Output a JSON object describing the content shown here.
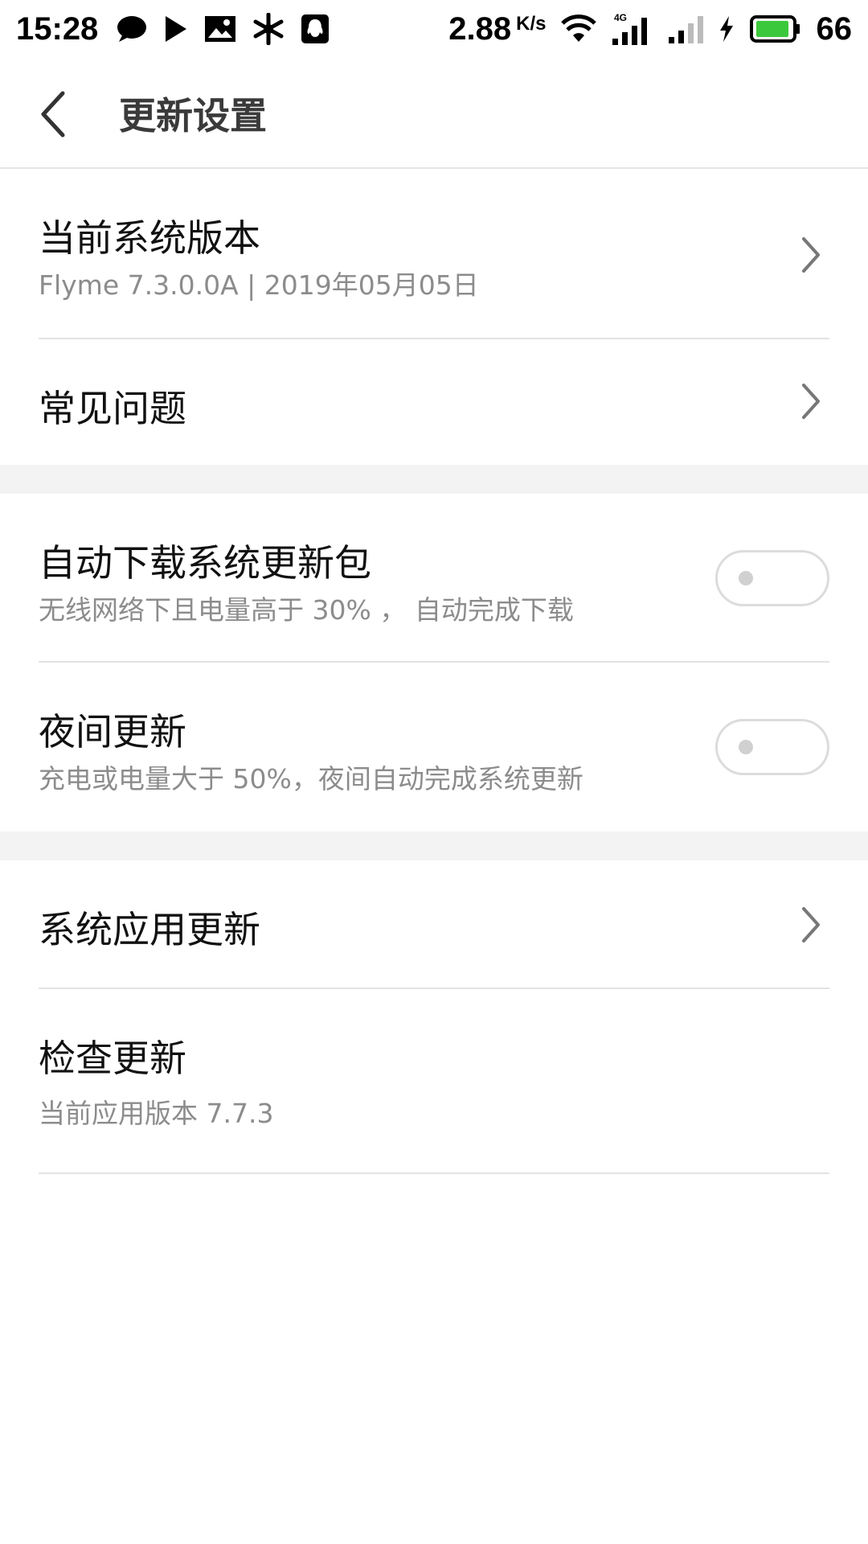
{
  "status_bar": {
    "time": "15:28",
    "speed": "2.88",
    "speed_unit": "K/s",
    "network": "4G",
    "battery": "66",
    "icons": [
      "chat-bubble-icon",
      "play-icon",
      "image-icon",
      "snowflake-icon",
      "qq-icon",
      "wifi-icon",
      "signal-4g-icon",
      "signal-icon",
      "charging-icon",
      "battery-icon"
    ]
  },
  "header": {
    "title": "更新设置"
  },
  "sections": [
    {
      "items": [
        {
          "title": "当前系统版本",
          "subtitle": "Flyme 7.3.0.0A | 2019年05月05日",
          "control": "chevron"
        },
        {
          "title": "常见问题",
          "control": "chevron"
        }
      ]
    },
    {
      "items": [
        {
          "title": "自动下载系统更新包",
          "subtitle": "无线网络下且电量高于 30% ， 自动完成下载",
          "control": "toggle",
          "toggled": false
        },
        {
          "title": "夜间更新",
          "subtitle": "充电或电量大于 50%，夜间自动完成系统更新",
          "control": "toggle",
          "toggled": false
        }
      ]
    },
    {
      "items": [
        {
          "title": "系统应用更新",
          "control": "chevron"
        },
        {
          "title": "检查更新",
          "subtitle": "当前应用版本 7.7.3"
        }
      ]
    }
  ],
  "colors": {
    "accent_battery": "#3cc83c",
    "divider": "#e3e3e3",
    "section_gap": "#f3f3f3",
    "subtitle": "#8c8c8c"
  }
}
